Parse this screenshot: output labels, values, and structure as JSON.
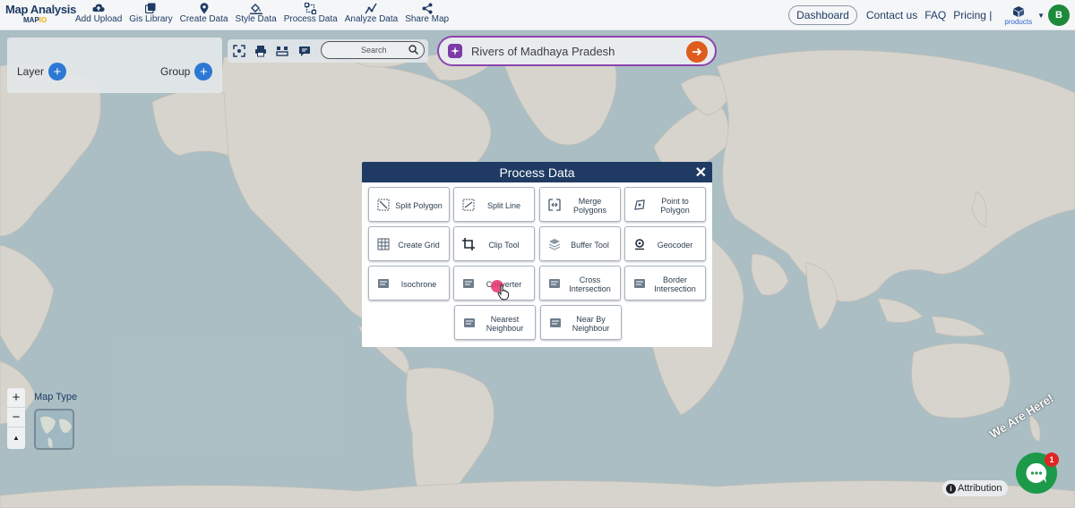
{
  "app": {
    "title": "Map Analysis",
    "subtitle_prefix": "MAP",
    "subtitle_suffix": "IO"
  },
  "nav": {
    "items": [
      {
        "label": "Add Upload",
        "icon": "cloud-upload-icon"
      },
      {
        "label": "Gis Library",
        "icon": "library-icon"
      },
      {
        "label": "Create Data",
        "icon": "location-pin-icon"
      },
      {
        "label": "Style Data",
        "icon": "paint-bucket-icon"
      },
      {
        "label": "Process Data",
        "icon": "process-icon"
      },
      {
        "label": "Analyze Data",
        "icon": "analyze-icon"
      },
      {
        "label": "Share Map",
        "icon": "share-icon"
      }
    ]
  },
  "header_right": {
    "dashboard": "Dashboard",
    "contact": "Contact us",
    "faq": "FAQ",
    "pricing": "Pricing |",
    "products": "products",
    "avatar_initial": "B"
  },
  "layer_panel": {
    "layer_label": "Layer",
    "group_label": "Group"
  },
  "toolbar": {
    "search_placeholder": "Search"
  },
  "query": {
    "text": "Rivers of Madhaya Pradesh"
  },
  "modal": {
    "title": "Process Data",
    "close": "✕",
    "tools": [
      "Split Polygon",
      "Split Line",
      "Merge Polygons",
      "Point to Polygon",
      "Create Grid",
      "Clip Tool",
      "Buffer Tool",
      "Geocoder",
      "Isochrone",
      "Converter",
      "Cross Intersection",
      "Border Intersection",
      "Nearest Neighbour",
      "Near By Neighbour"
    ]
  },
  "map_controls": {
    "zoom_in": "+",
    "zoom_out": "−",
    "reset": "▲",
    "map_type_label": "Map Type"
  },
  "footer": {
    "attribution": "Attribution",
    "attribution_icon": "i",
    "chat_badge": "1",
    "chat_banner": "We Are Here!"
  },
  "colors": {
    "brand_navy": "#1f3b64",
    "accent_purple": "#8e44ad",
    "go_orange": "#e05b1e",
    "chat_green": "#1c9a4a",
    "plus_blue": "#2c78d4"
  }
}
